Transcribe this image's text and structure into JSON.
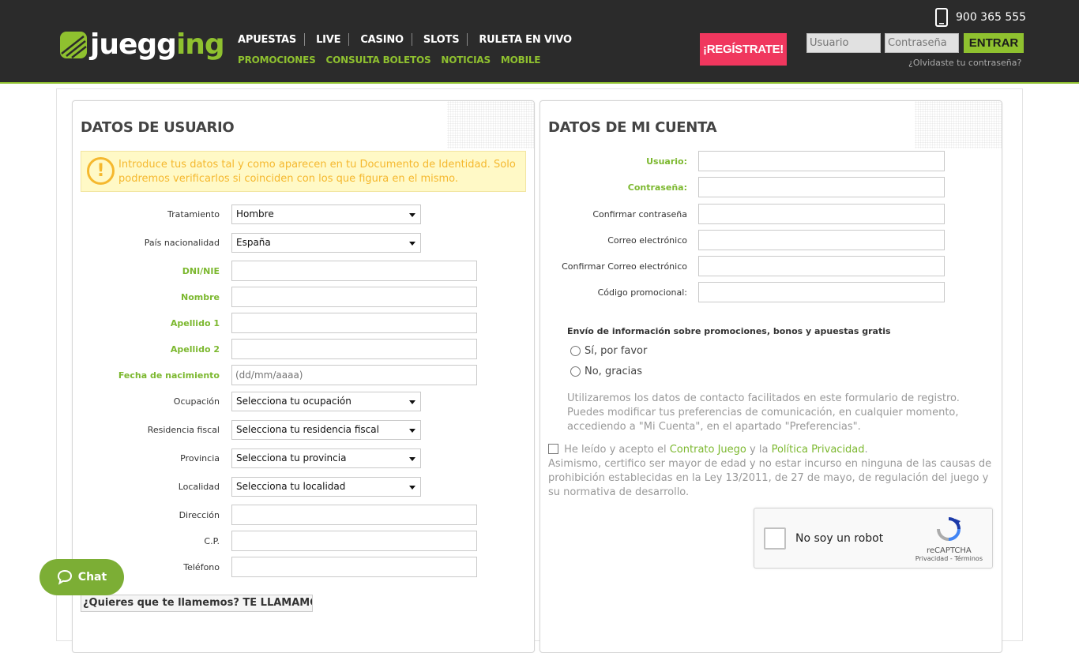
{
  "header": {
    "brand_prefix": "juegg",
    "brand_suffix": "ing",
    "phone": "900 365 555",
    "nav_main": [
      "APUESTAS",
      "LIVE",
      "CASINO",
      "SLOTS",
      "RULETA EN VIVO"
    ],
    "nav_sub": [
      "PROMOCIONES",
      "CONSULTA BOLETOS",
      "NOTICIAS",
      "MOBILE"
    ],
    "register_label": "¡REGÍSTRATE!",
    "username_placeholder": "Usuario",
    "password_placeholder": "Contraseña",
    "enter_label": "ENTRAR",
    "forgot_label": "¿Olvidaste tu contraseña?"
  },
  "user_panel": {
    "title": "DATOS DE USUARIO",
    "notice": "Introduce tus datos tal y como aparecen en tu Documento de Identidad. Solo podremos verificarlos si coinciden con los que figura en el mismo.",
    "fields": {
      "tratamiento": {
        "label": "Tratamiento",
        "value": "Hombre"
      },
      "pais": {
        "label": "País nacionalidad",
        "value": "España"
      },
      "dni": {
        "label": "DNI/NIE"
      },
      "nombre": {
        "label": "Nombre"
      },
      "apellido1": {
        "label": "Apellido 1"
      },
      "apellido2": {
        "label": "Apellido 2"
      },
      "fecha": {
        "label": "Fecha de nacimiento",
        "placeholder": "(dd/mm/aaaa)"
      },
      "ocupacion": {
        "label": "Ocupación",
        "value": "Selecciona tu ocupación"
      },
      "residencia": {
        "label": "Residencia fiscal",
        "value": "Selecciona tu residencia fiscal"
      },
      "provincia": {
        "label": "Provincia",
        "value": "Selecciona tu provincia"
      },
      "localidad": {
        "label": "Localidad",
        "value": "Selecciona tu localidad"
      },
      "direccion": {
        "label": "Dirección"
      },
      "cp": {
        "label": "C.P."
      },
      "telefono": {
        "label": "Teléfono"
      }
    },
    "callme": "¿Quieres que te llamemos? TE LLAMAMOS"
  },
  "account_panel": {
    "title": "DATOS DE MI CUENTA",
    "fields": {
      "usuario": {
        "label": "Usuario:"
      },
      "contrasena": {
        "label": "Contraseña:"
      },
      "confirmar_contrasena": {
        "label": "Confirmar contraseña"
      },
      "correo": {
        "label": "Correo electrónico"
      },
      "confirmar_correo": {
        "label": "Confirmar Correo electrónico"
      },
      "codigo": {
        "label": "Código promocional:"
      }
    },
    "promo_title": "Envío de información sobre promociones, bonos y apuestas gratis",
    "promo_yes": "Sí, por favor",
    "promo_no": "No, gracias",
    "privacy_note": "Utilizaremos los datos de contacto facilitados en este formulario de registro. Puedes modificar tus preferencias de comunicación, en cualquier momento, accediendo a \"Mi Cuenta\", en el apartado \"Preferencias\".",
    "terms_pre": "He leído y acepto el",
    "terms_link1": "Contrato Juego",
    "terms_and": "y la",
    "terms_link2": "Política Privacidad",
    "terms_dot": ".",
    "terms_rest": "Asimismo, certifico ser mayor de edad y no estar incurso en ninguna de las causas de prohibición establecidas en la Ley 13/2011, de 27 de mayo, de regulación del juego y su normativa de desarrollo.",
    "captcha_label": "No soy un robot",
    "captcha_brand": "reCAPTCHA",
    "captcha_links": "Privacidad - Términos"
  },
  "chat_label": "Chat",
  "colors": {
    "accent": "#8fc12f",
    "register": "#f0375e",
    "header_bg": "#2b2b2b"
  }
}
